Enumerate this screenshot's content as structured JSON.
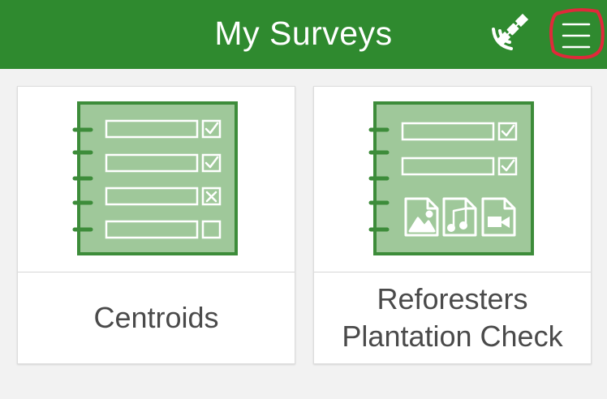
{
  "header": {
    "title": "My Surveys"
  },
  "icons": {
    "gps": "satellite-gps-icon",
    "menu": "hamburger-menu-icon"
  },
  "colors": {
    "header_bg": "#2f8a2f",
    "form_icon_bg": "#9fc89a",
    "form_icon_border": "#3d8c3a",
    "menu_annotation": "#e0293a"
  },
  "surveys": [
    {
      "name": "Centroids"
    },
    {
      "name": "Reforesters Plantation Check"
    }
  ]
}
